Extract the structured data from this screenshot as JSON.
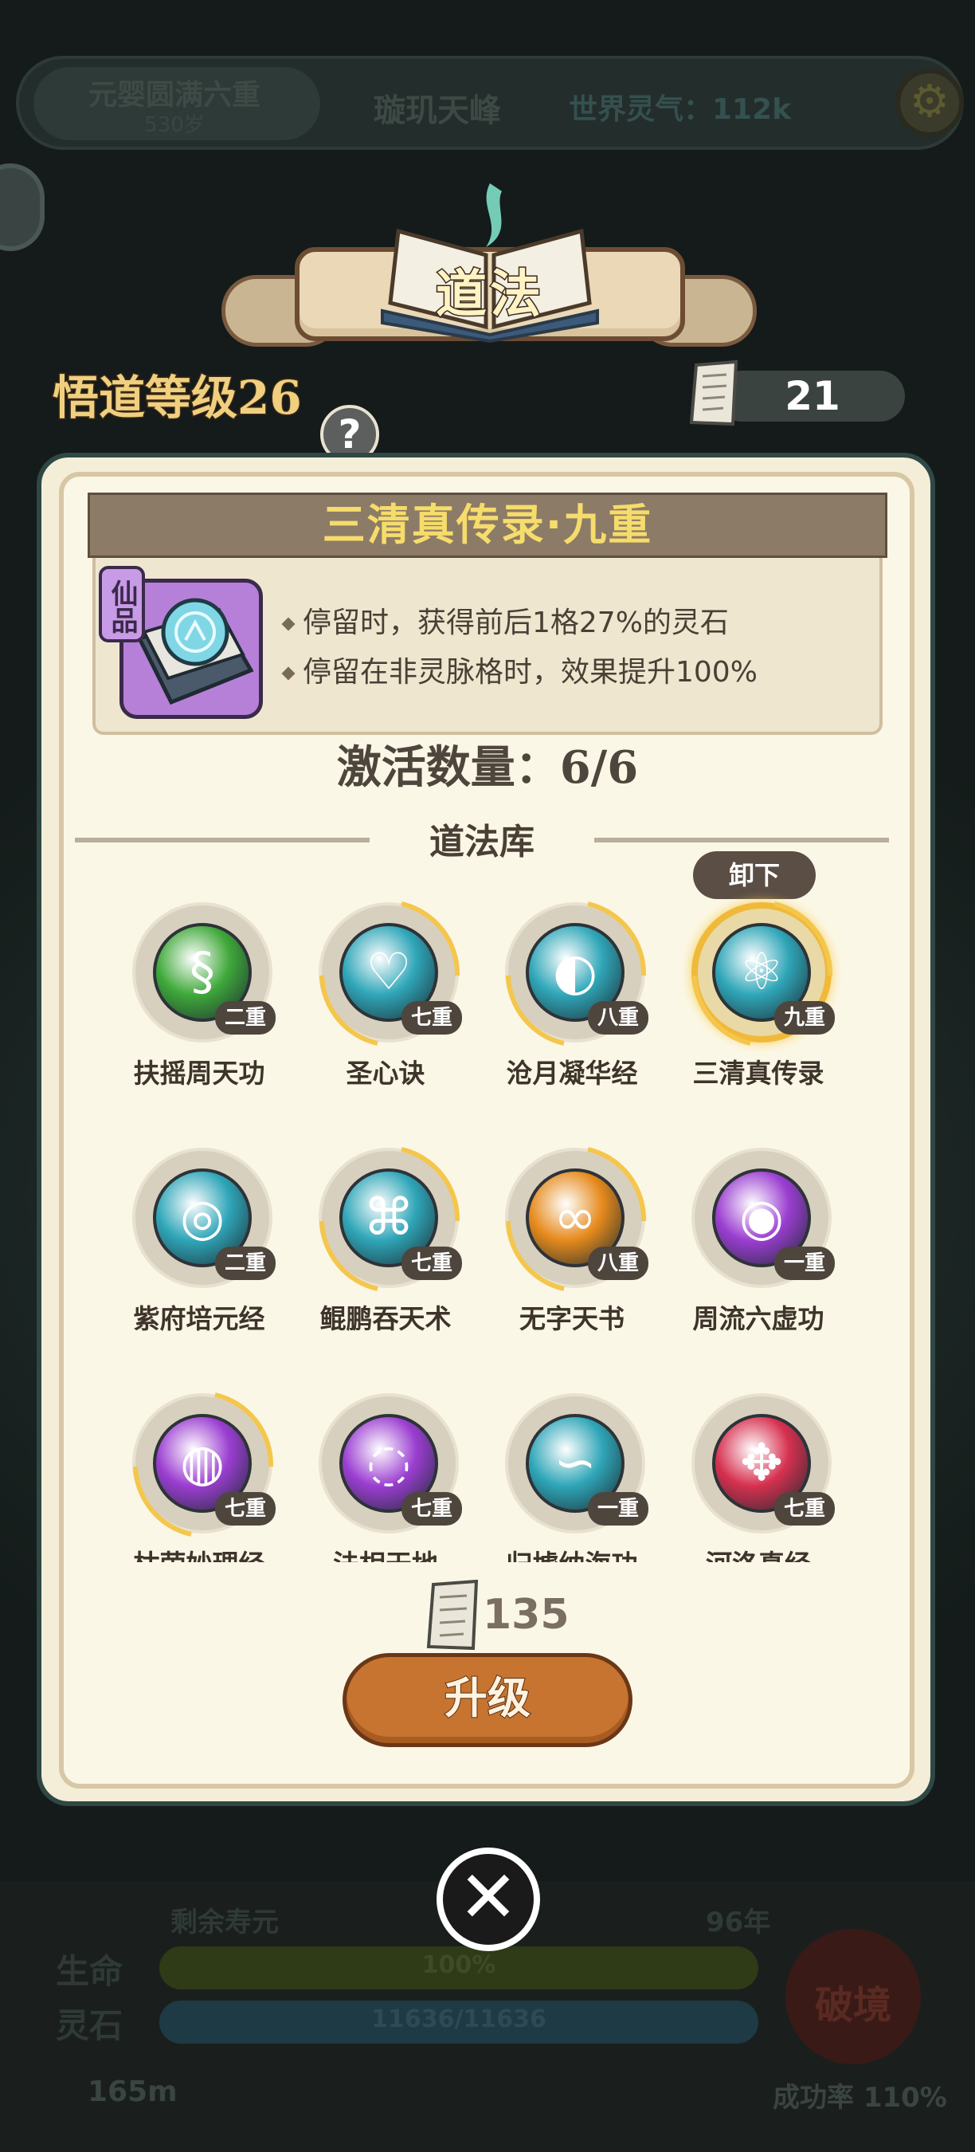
{
  "top_bar": {
    "realm": "元婴圆满六重",
    "age": "530岁",
    "peak_name": "璇玑天峰",
    "world_qi": "世界灵气：112k"
  },
  "bottom_hud": {
    "lifespan_label": "剩余寿元",
    "lifespan_value": "96年",
    "hp_label": "生命",
    "hp_value": "100%",
    "spirit_label": "灵石",
    "spirit_value": "11636/11636",
    "distance": "165m",
    "breakthrough_label": "破境",
    "success_rate": "成功率 110%"
  },
  "header": {
    "title": "道法",
    "insight_level": "悟道等级26",
    "scroll_count": "21",
    "help": "?"
  },
  "selected_skill": {
    "name": "三清真传录·九重",
    "grade": "仙品",
    "effects": [
      "停留时，获得前后1格27%的灵石",
      "停留在非灵脉格时，效果提升100%"
    ]
  },
  "active_count": "激活数量：6/6",
  "library_title": "道法库",
  "unequip_label": "卸下",
  "skills": [
    {
      "name": "扶摇周天功",
      "level": "二重",
      "color": "#3fa83a",
      "equipped": false,
      "glow": false
    },
    {
      "name": "圣心诀",
      "level": "七重",
      "color": "#2fa6b8",
      "equipped": false,
      "glow": true
    },
    {
      "name": "沧月凝华经",
      "level": "八重",
      "color": "#2fa6b8",
      "equipped": false,
      "glow": true
    },
    {
      "name": "三清真传录",
      "level": "九重",
      "color": "#2fa6b8",
      "equipped": true,
      "glow": true
    },
    {
      "name": "紫府培元经",
      "level": "二重",
      "color": "#2fa6b8",
      "equipped": false,
      "glow": false
    },
    {
      "name": "鲲鹏吞天术",
      "level": "七重",
      "color": "#2fa6b8",
      "equipped": false,
      "glow": true
    },
    {
      "name": "无字天书",
      "level": "八重",
      "color": "#e68a1c",
      "equipped": false,
      "glow": true
    },
    {
      "name": "周流六虚功",
      "level": "一重",
      "color": "#9b3ed1",
      "equipped": false,
      "glow": false
    },
    {
      "name": "枯荣妙理经",
      "level": "七重",
      "color": "#9b3ed1",
      "equipped": false,
      "glow": true
    },
    {
      "name": "法相天地",
      "level": "七重",
      "color": "#9b3ed1",
      "equipped": false,
      "glow": false
    },
    {
      "name": "归墟纳海功",
      "level": "一重",
      "color": "#2fa6b8",
      "equipped": false,
      "glow": false
    },
    {
      "name": "河洛真经",
      "level": "七重",
      "color": "#d6304f",
      "equipped": false,
      "glow": false
    }
  ],
  "upgrade": {
    "cost": "135",
    "label": "升级"
  },
  "icons": {
    "settings": "gear-icon",
    "close": "close-icon",
    "scroll": "scroll-icon",
    "book": "book-icon"
  }
}
